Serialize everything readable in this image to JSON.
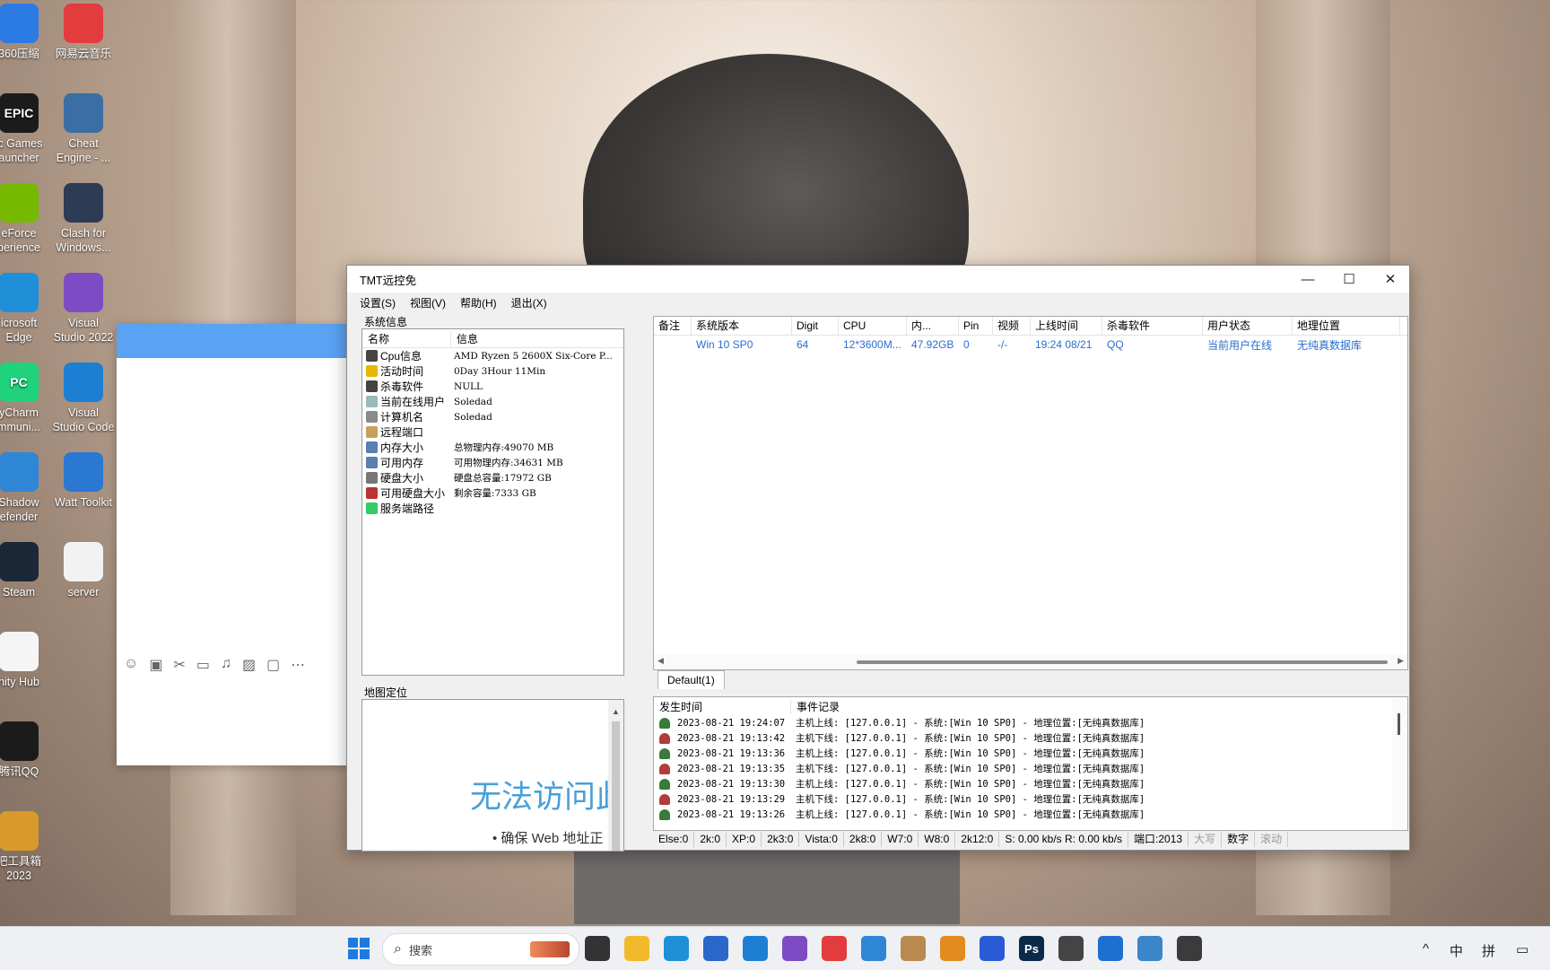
{
  "desktop": {
    "icons": [
      {
        "label": "360压缩",
        "icon": "archive-icon",
        "color": "#2c7be5"
      },
      {
        "label": "网易云音乐",
        "icon": "music-icon",
        "color": "#e33c3c"
      },
      {
        "label": "ic Games\nauncher",
        "icon": "epic-games-icon",
        "color": "#1b1b1b",
        "glyph": "EPIC"
      },
      {
        "label": "Cheat\nEngine - ...",
        "icon": "cheat-engine-icon",
        "color": "#3a6ea5"
      },
      {
        "label": "eForce\nperience",
        "icon": "geforce-icon",
        "color": "#76b900"
      },
      {
        "label": "Clash for\nWindows...",
        "icon": "clash-icon",
        "color": "#2d3b55"
      },
      {
        "label": "icrosoft\nEdge",
        "icon": "edge-icon",
        "color": "#1f8fd8"
      },
      {
        "label": "Visual\nStudio 2022",
        "icon": "visual-studio-icon",
        "color": "#7d4cc4"
      },
      {
        "label": "yCharm\nmmuni...",
        "icon": "pycharm-icon",
        "color": "#1ed37c",
        "glyph": "PC"
      },
      {
        "label": "Visual\nStudio Code",
        "icon": "vscode-icon",
        "color": "#1d7fd3"
      },
      {
        "label": "Shadow\nefender",
        "icon": "shield-icon",
        "color": "#2f86d6"
      },
      {
        "label": "Watt Toolkit",
        "icon": "watt-toolkit-icon",
        "color": "#2b78d3"
      },
      {
        "label": "Steam",
        "icon": "steam-icon",
        "color": "#1b2838"
      },
      {
        "label": "server",
        "icon": "clock-icon",
        "color": "#f2f2f2"
      },
      {
        "label": "nity Hub",
        "icon": "unity-icon",
        "color": "#f5f5f5"
      },
      {
        "label": "腾讯QQ",
        "icon": "qq-icon",
        "color": "#1b1b1b"
      },
      {
        "label": "吧工具箱\n2023",
        "icon": "toolbox-icon",
        "color": "#d99a2b"
      }
    ]
  },
  "window": {
    "title": "TMT远控免",
    "menu": [
      "设置(S)",
      "视图(V)",
      "帮助(H)",
      "退出(X)"
    ],
    "controls": {
      "minimize": "—",
      "maximize": "☐",
      "close": "✕"
    },
    "sysinfo": {
      "group_label": "系统信息",
      "columns": [
        "名称",
        "信息"
      ],
      "rows": [
        {
          "name": "Cpu信息",
          "value": "AMD Ryzen 5 2600X Six-Core P...",
          "icon": "cpu-icon",
          "color": "#444"
        },
        {
          "name": "活动时间",
          "value": "0Day 3Hour 11Min",
          "icon": "clock-icon",
          "color": "#e6b800"
        },
        {
          "name": "杀毒软件",
          "value": "NULL",
          "icon": "antivirus-icon",
          "color": "#444"
        },
        {
          "name": "当前在线用户",
          "value": "Soledad",
          "icon": "user-icon",
          "color": "#9bb"
        },
        {
          "name": "计算机名",
          "value": "Soledad",
          "icon": "computer-icon",
          "color": "#8a8a8a"
        },
        {
          "name": "远程端口",
          "value": "",
          "icon": "network-icon",
          "color": "#c9a05a"
        },
        {
          "name": "内存大小",
          "value": "总物理内存:49070 MB",
          "icon": "memory-icon",
          "color": "#5a7fb0"
        },
        {
          "name": "可用内存",
          "value": "可用物理内存:34631 MB",
          "icon": "memory-icon",
          "color": "#5a7fb0"
        },
        {
          "name": "硬盘大小",
          "value": "硬盘总容量:17972 GB",
          "icon": "disk-icon",
          "color": "#777"
        },
        {
          "name": "可用硬盘大小",
          "value": "剩余容量:7333 GB",
          "icon": "disk-free-icon",
          "color": "#b33"
        },
        {
          "name": "服务端路径",
          "value": "",
          "icon": "folder-icon",
          "color": "#3c6"
        }
      ]
    },
    "map": {
      "group_label": "地图定位",
      "message": "无法访问此",
      "bullet": "确保 Web 地址正"
    },
    "hosts": {
      "columns": [
        "备注",
        "系统版本",
        "Digit",
        "CPU",
        "内...",
        "Pin",
        "视频",
        "上线时间",
        "杀毒软件",
        "用户状态",
        "地理位置"
      ],
      "rows": [
        [
          "",
          "Win 10 SP0",
          "64",
          "12*3600M...",
          "47.92GB",
          "0",
          "-/-",
          "19:24 08/21",
          "QQ",
          "当前用户在线",
          "无纯真数据库"
        ]
      ]
    },
    "tab": "Default(1)",
    "log": {
      "columns": [
        "发生时间",
        "事件记录"
      ],
      "rows": [
        {
          "time": "2023-08-21 19:24:07",
          "event": "主机上线: [127.0.0.1]  -  系统:[Win 10 SP0]  -  地理位置:[无纯真数据库]",
          "kind": "online"
        },
        {
          "time": "2023-08-21 19:13:42",
          "event": "主机下线: [127.0.0.1]  -  系统:[Win 10 SP0]  -  地理位置:[无纯真数据库]",
          "kind": "offline"
        },
        {
          "time": "2023-08-21 19:13:36",
          "event": "主机上线: [127.0.0.1]  -  系统:[Win 10 SP0]  -  地理位置:[无纯真数据库]",
          "kind": "online"
        },
        {
          "time": "2023-08-21 19:13:35",
          "event": "主机下线: [127.0.0.1]  -  系统:[Win 10 SP0]  -  地理位置:[无纯真数据库]",
          "kind": "offline"
        },
        {
          "time": "2023-08-21 19:13:30",
          "event": "主机上线: [127.0.0.1]  -  系统:[Win 10 SP0]  -  地理位置:[无纯真数据库]",
          "kind": "online"
        },
        {
          "time": "2023-08-21 19:13:29",
          "event": "主机下线: [127.0.0.1]  -  系统:[Win 10 SP0]  -  地理位置:[无纯真数据库]",
          "kind": "offline"
        },
        {
          "time": "2023-08-21 19:13:26",
          "event": "主机上线: [127.0.0.1]  -  系统:[Win 10 SP0]  -  地理位置:[无纯真数据库]",
          "kind": "online"
        }
      ]
    },
    "status": {
      "cells": [
        "Else:0",
        "2k:0",
        "XP:0",
        "2k3:0",
        "Vista:0",
        "2k8:0",
        "W7:0",
        "W8:0",
        "2k12:0",
        "S: 0.00 kb/s R: 0.00 kb/s",
        "端口:2013"
      ],
      "indicators": [
        {
          "label": "大写",
          "active": false
        },
        {
          "label": "数字",
          "active": true
        },
        {
          "label": "滚动",
          "active": false
        }
      ]
    }
  },
  "taskbar": {
    "search_placeholder": "搜索",
    "apps": [
      {
        "icon": "task-view-icon",
        "color": "#333"
      },
      {
        "icon": "file-explorer-icon",
        "color": "#f2b92b"
      },
      {
        "icon": "edge-icon",
        "color": "#1f8fd8"
      },
      {
        "icon": "store-icon",
        "color": "#2968c8"
      },
      {
        "icon": "vscode-icon",
        "color": "#1d7fd3"
      },
      {
        "icon": "visual-studio-icon",
        "color": "#7d4cc4"
      },
      {
        "icon": "music-icon",
        "color": "#e33c3c"
      },
      {
        "icon": "shadow-defender-icon",
        "color": "#2f86d6"
      },
      {
        "icon": "package-icon",
        "color": "#b88a50"
      },
      {
        "icon": "search-tool-icon",
        "color": "#e38b1e"
      },
      {
        "icon": "notepad-icon",
        "color": "#2a5bd7"
      },
      {
        "icon": "photoshop-icon",
        "color": "#0b2a4a",
        "glyph": "Ps"
      },
      {
        "icon": "ghost-icon",
        "color": "#444"
      },
      {
        "icon": "defender-icon",
        "color": "#1f6fd1"
      },
      {
        "icon": "monitor-icon",
        "color": "#3a86c9"
      },
      {
        "icon": "tmt-icon",
        "color": "#3b3b3b"
      }
    ],
    "tray": [
      "^",
      "中",
      "拼"
    ]
  }
}
